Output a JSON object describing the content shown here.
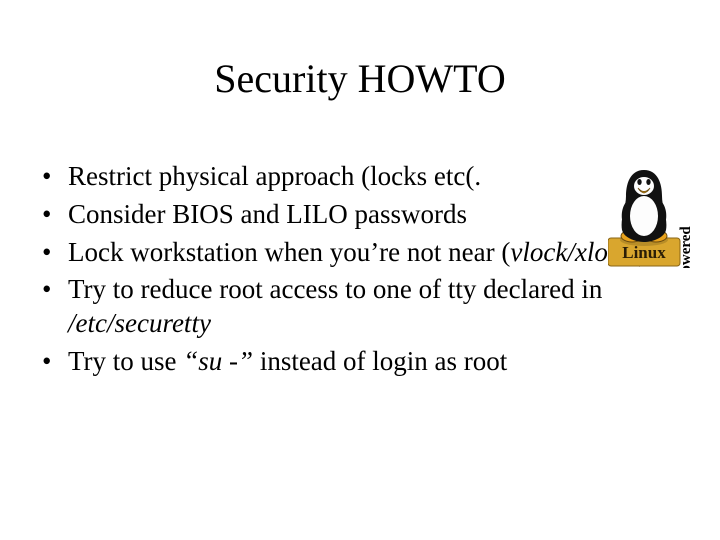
{
  "title": "Security HOWTO",
  "bullets": [
    {
      "pre": "Restrict physical approach (locks etc(.",
      "it": "",
      "post": ""
    },
    {
      "pre": "Consider BIOS and LILO passwords",
      "it": "",
      "post": ""
    },
    {
      "pre": "Lock workstation when you’re not near (",
      "it": "vlock/xlock",
      "post": "("
    },
    {
      "pre": "Try to reduce root access to one of tty declared in ",
      "it": "/etc/securetty",
      "post": ""
    },
    {
      "pre": "Try to use ",
      "it": "“su -”",
      "post": " instead of login as root"
    }
  ],
  "logo": {
    "brand": "Linux",
    "powered": "Powered",
    "icon": "tux-penguin"
  }
}
